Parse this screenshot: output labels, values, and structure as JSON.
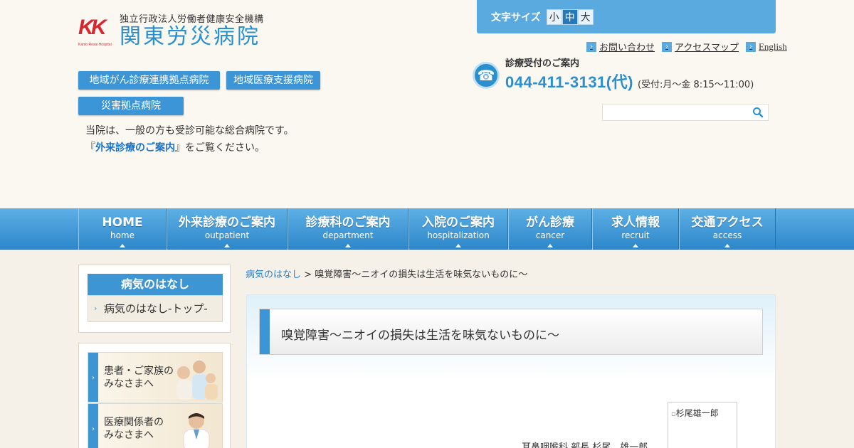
{
  "header": {
    "logo": {
      "org": "独立行政法人労働者健康安全機構",
      "name": "関東労災病院",
      "mark": "KK",
      "mark_sub": "Kanto Rosai Hospital"
    },
    "badges": [
      "地域がん診療連携拠点病院",
      "地域医療支援病院",
      "災害拠点病院"
    ],
    "intro_line1": "当院は、一般の方も受診可能な総合病院です。",
    "intro_line2_prefix": "『",
    "intro_link": "外来診療のご案内",
    "intro_line2_suffix": "』をご覧ください。",
    "font_size": {
      "label": "文字サイズ",
      "options": [
        "小",
        "中",
        "大"
      ],
      "selected": "中"
    },
    "top_links": [
      "お問い合わせ",
      "アクセスマップ",
      "English"
    ],
    "phone": {
      "label": "診療受付のご案内",
      "number": "044-411-3131(代)",
      "hours": "(受付:月〜金 8:15〜11:00)"
    },
    "search": {
      "placeholder": ""
    }
  },
  "nav": [
    {
      "ja": "HOME",
      "en": "home"
    },
    {
      "ja": "外来診療のご案内",
      "en": "outpatient"
    },
    {
      "ja": "診療科のご案内",
      "en": "department"
    },
    {
      "ja": "入院のご案内",
      "en": "hospitalization"
    },
    {
      "ja": "がん診療",
      "en": "cancer"
    },
    {
      "ja": "求人情報",
      "en": "recruit"
    },
    {
      "ja": "交通アクセス",
      "en": "access"
    }
  ],
  "sidebar": {
    "box_title": "病気のはなし",
    "box_item": "病気のはなし-トップ-",
    "cards": [
      {
        "line1": "患者・ご家族の",
        "line2": "みなさまへ"
      },
      {
        "line1": "医療関係者の",
        "line2": "みなさまへ"
      }
    ]
  },
  "breadcrumb": {
    "link": "病気のはなし",
    "sep": " > ",
    "current": "嗅覚障害～ニオイの損失は生活を味気ないものに～"
  },
  "article": {
    "title": "嗅覚障害～ニオイの損失は生活を味気ないものに～",
    "author": "耳鼻咽喉科 部長 杉尾　雄一郎",
    "photo_alt": "杉尾雄一郎"
  },
  "colors": {
    "accent": "#3b95d6",
    "brand_red": "#d8262f",
    "link": "#1a73c8"
  }
}
